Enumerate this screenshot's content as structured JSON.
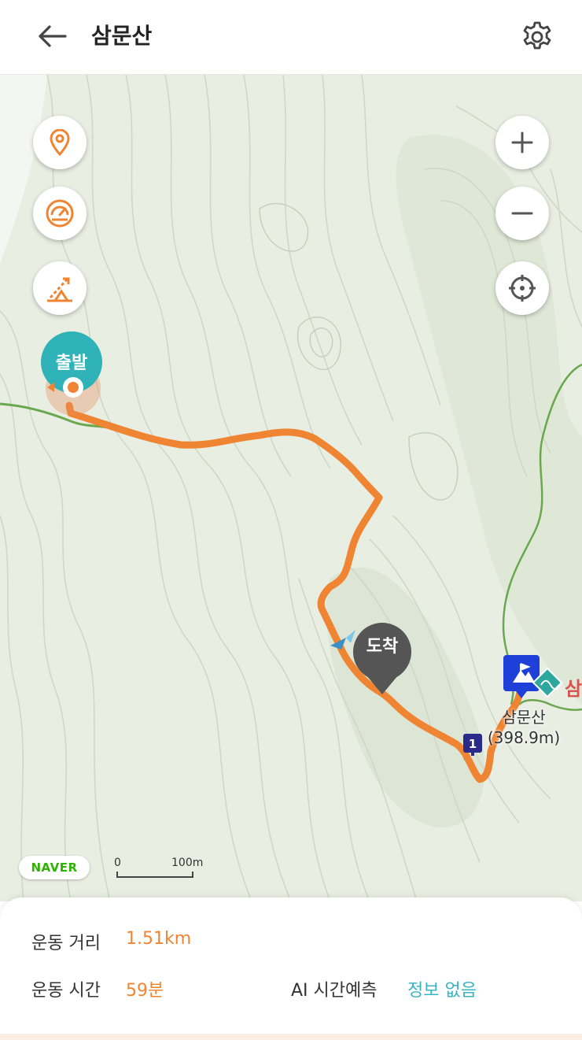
{
  "header": {
    "title": "삼문산",
    "back_icon": "arrow-left-icon",
    "settings_icon": "gear-icon"
  },
  "map": {
    "controls_left": [
      "location-pin-icon",
      "speedometer-icon",
      "slope-icon"
    ],
    "controls_right": [
      "zoom-in-icon",
      "zoom-out-icon",
      "locate-crosshair-icon"
    ],
    "start_label": "출발",
    "arrive_label": "도착",
    "peak": {
      "name": "삼문산",
      "elevation": "(398.9m)",
      "cut_label": "삼"
    },
    "waypoint_number": "1",
    "provider_logo": "NAVER",
    "scale": {
      "zero": "0",
      "length": "100m"
    },
    "route_color": "#ef8533",
    "trail_color": "#6aa84f"
  },
  "stats": {
    "distance_label": "운동 거리",
    "distance_value": "1.51km",
    "time_label": "운동 시간",
    "time_value": "59분",
    "ai_label": "AI 시간예측",
    "ai_value": "정보 없음"
  },
  "colors": {
    "accent": "#ef8533",
    "teal": "#3ab5c0",
    "start_bubble": "#2fb2b8",
    "peak_marker": "#1e3fd8"
  }
}
